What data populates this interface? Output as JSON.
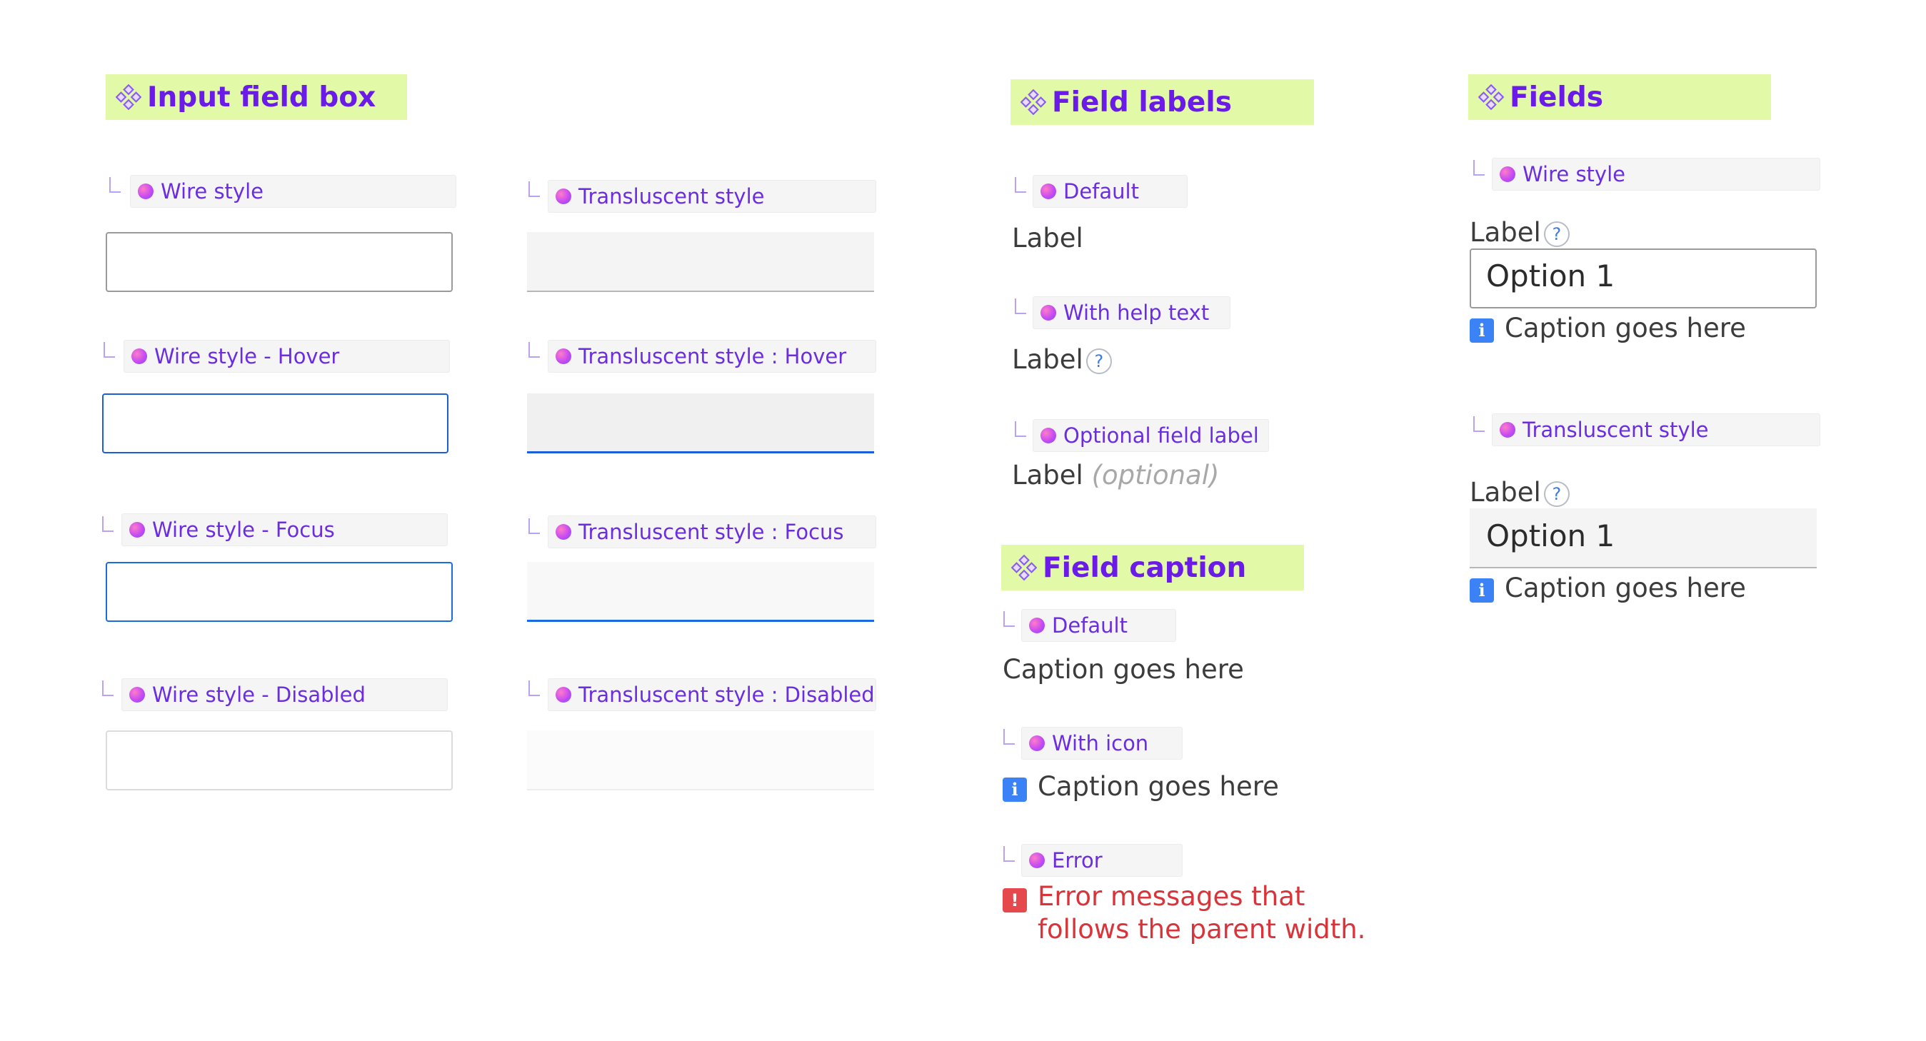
{
  "sections": {
    "input_field_box": "Input field box",
    "field_labels": "Field labels",
    "field_caption": "Field caption",
    "fields": "Fields"
  },
  "input_box_variants": {
    "wire_style": "Wire style",
    "wire_hover": "Wire style - Hover",
    "wire_focus": "Wire style - Focus",
    "wire_disabled": "Wire style - Disabled",
    "trans_style": "Transluscent style",
    "trans_hover": "Transluscent style : Hover",
    "trans_focus": "Transluscent style : Focus",
    "trans_disabled": "Transluscent style : Disabled"
  },
  "labels": {
    "default_tag": "Default",
    "with_help_tag": "With help text",
    "optional_tag": "Optional field label",
    "label": "Label",
    "optional": "(optional)",
    "help_symbol": "?"
  },
  "captions": {
    "default_tag": "Default",
    "with_icon_tag": "With icon",
    "error_tag": "Error",
    "caption": "Caption goes here",
    "error_line1": "Error messages that",
    "error_line2": "follows the parent width.",
    "info_symbol": "i",
    "error_symbol": "!"
  },
  "fields": {
    "wire_tag": "Wire style",
    "trans_tag": "Transluscent style",
    "label": "Label",
    "value": "Option 1",
    "caption": "Caption goes here",
    "help_symbol": "?",
    "info_symbol": "i"
  },
  "colors": {
    "header_bg": "#e2f9a8",
    "header_text": "#6a1be8",
    "accent_blue": "#1a5fd8",
    "error_red": "#d8343a",
    "info_blue": "#3b82f6"
  }
}
